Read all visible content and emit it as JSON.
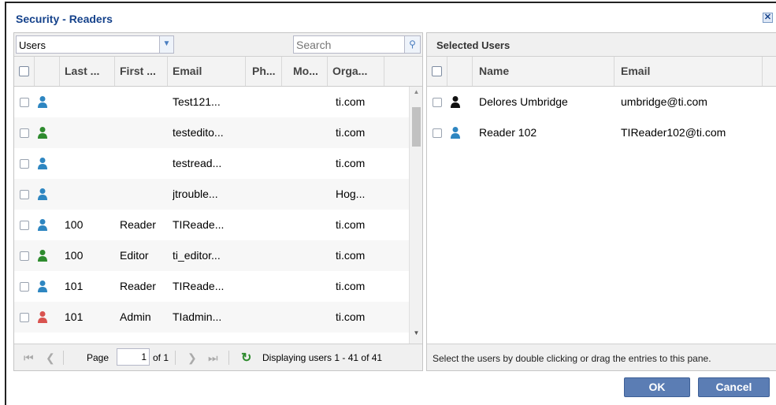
{
  "dialog": {
    "title": "Security - Readers",
    "close_glyph": "✕"
  },
  "left": {
    "combo_value": "Users",
    "search_placeholder": "Search",
    "columns": [
      "Last ...",
      "First ...",
      "Email",
      "Ph...",
      "Mo...",
      "Orga..."
    ],
    "rows": [
      {
        "last": "",
        "first": "",
        "email": "Test121...",
        "org": "ti.com",
        "icon": "user-blue-icon",
        "color": "#2e86c1"
      },
      {
        "last": "",
        "first": "",
        "email": "testedito...",
        "org": "ti.com",
        "icon": "user-green-icon",
        "color": "#2e8b2e"
      },
      {
        "last": "",
        "first": "",
        "email": "testread...",
        "org": "ti.com",
        "icon": "user-blue-icon",
        "color": "#2e86c1"
      },
      {
        "last": "",
        "first": "",
        "email": "jtrouble...",
        "org": "Hog...",
        "icon": "user-blue-icon",
        "color": "#2e86c1"
      },
      {
        "last": "100",
        "first": "Reader",
        "email": "TIReade...",
        "org": "ti.com",
        "icon": "user-blue-icon",
        "color": "#2e86c1"
      },
      {
        "last": "100",
        "first": "Editor",
        "email": "ti_editor...",
        "org": "ti.com",
        "icon": "user-green-icon",
        "color": "#2e8b2e"
      },
      {
        "last": "101",
        "first": "Reader",
        "email": "TIReade...",
        "org": "ti.com",
        "icon": "user-blue-icon",
        "color": "#2e86c1"
      },
      {
        "last": "101",
        "first": "Admin",
        "email": "TIadmin...",
        "org": "ti.com",
        "icon": "user-red-icon",
        "color": "#d9534f"
      }
    ],
    "pager": {
      "page_label": "Page",
      "page_value": "1",
      "of_label": "of 1",
      "display": "Displaying users 1 - 41 of 41"
    }
  },
  "right": {
    "title": "Selected Users",
    "columns": [
      "Name",
      "Email"
    ],
    "rows": [
      {
        "name": "Delores Umbridge",
        "email": "umbridge@ti.com",
        "icon": "user-black-icon",
        "color": "#111111"
      },
      {
        "name": "Reader 102",
        "email": "TIReader102@ti.com",
        "icon": "user-blue-icon",
        "color": "#2e86c1"
      }
    ],
    "footer": "Select the users by double clicking or drag the entries to this pane."
  },
  "buttons": {
    "ok": "OK",
    "cancel": "Cancel"
  }
}
